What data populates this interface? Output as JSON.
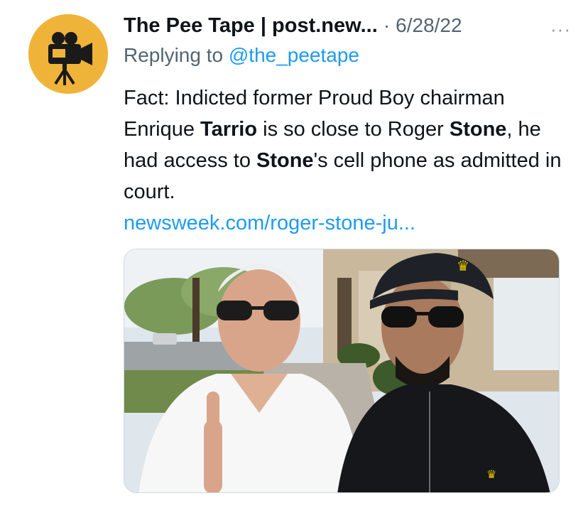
{
  "tweet": {
    "author_name": "The Pee Tape | post.new...",
    "separator": "·",
    "date": "6/28/22",
    "more_icon": "more-horizontal-icon",
    "reply_prefix": "Replying to",
    "reply_handle": "@the_peetape",
    "text": {
      "p1": "Fact: Indicted former Proud Boy chairman Enrique ",
      "b1": "Tarrio",
      "p2": " is so close to Roger ",
      "b2": "Stone",
      "p3": ", he had access to ",
      "b3": "Stone",
      "p4": "'s cell phone as admitted in court.",
      "link": "newsweek.com/roger-stone-ju..."
    },
    "avatar_icon": "video-camera-icon",
    "colors": {
      "avatar_bg": "#f0b33a",
      "link": "#1d9bf0",
      "secondary_text": "#536471"
    }
  }
}
